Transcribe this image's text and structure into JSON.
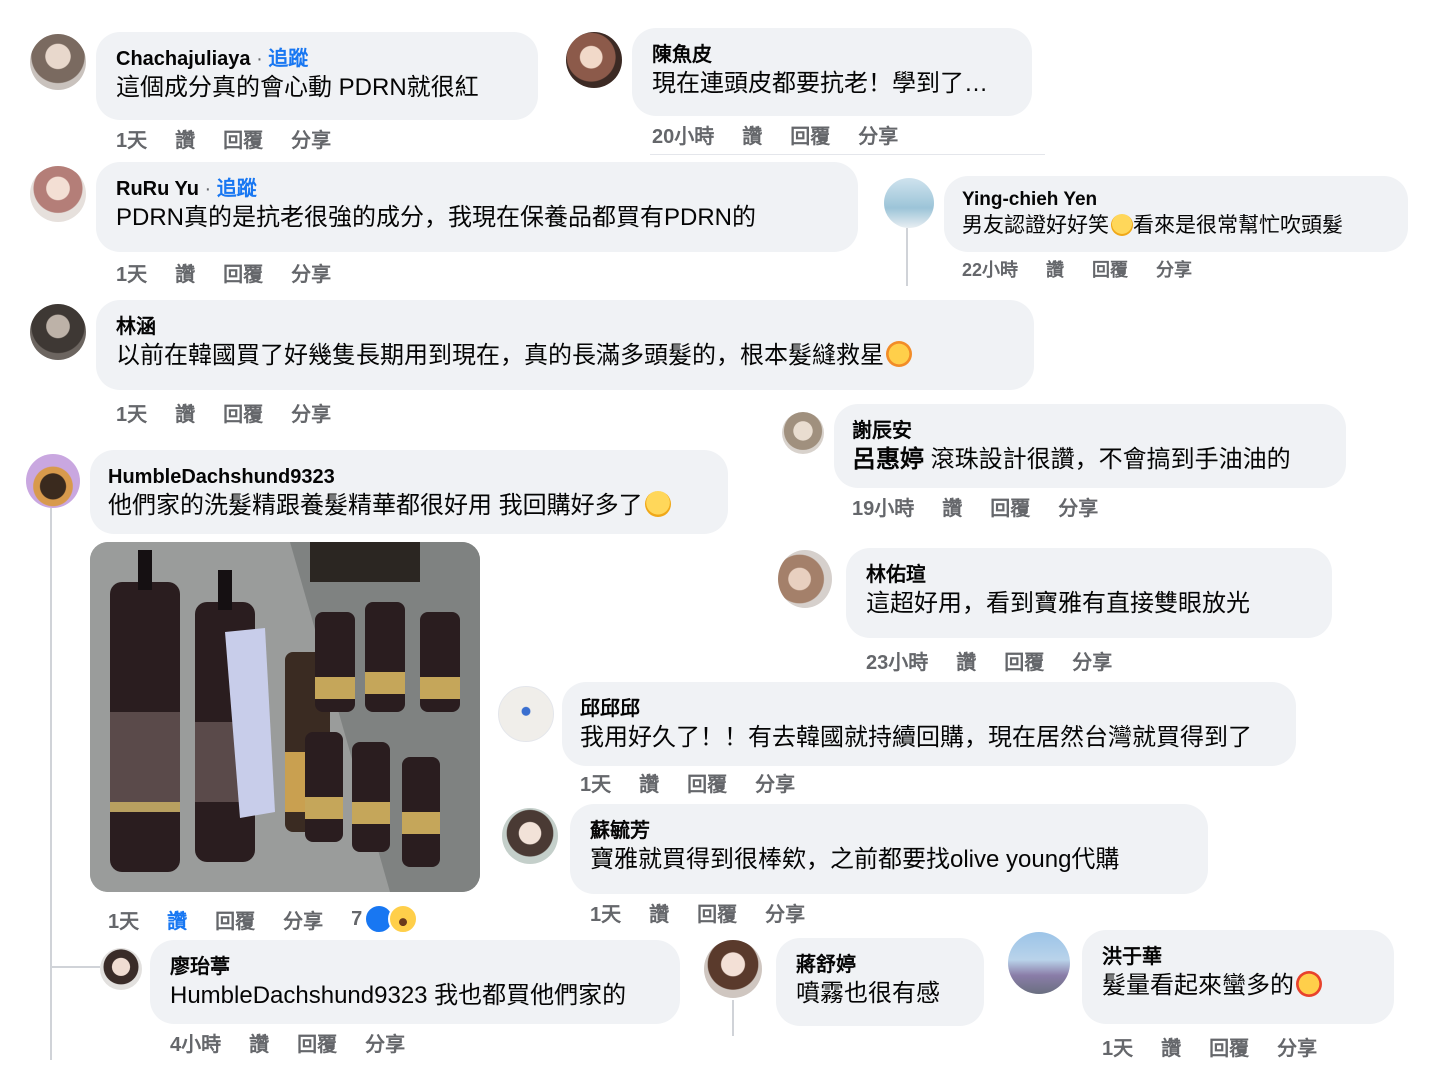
{
  "comments": [
    {
      "name": "Chachajuliaya",
      "follow": "追蹤",
      "text": "這個成分真的會心動 PDRN就很紅",
      "time": "1天",
      "like": "讚",
      "reply": "回覆",
      "share": "分享"
    },
    {
      "name": "陳魚皮",
      "text": "現在連頭皮都要抗老！學到了…",
      "time": "20小時",
      "like": "讚",
      "reply": "回覆",
      "share": "分享"
    },
    {
      "name": "RuRu Yu",
      "follow": "追蹤",
      "text": "PDRN真的是抗老很強的成分，我現在保養品都買有PDRN的",
      "time": "1天",
      "like": "讚",
      "reply": "回覆",
      "share": "分享"
    },
    {
      "name": "Ying-chieh Yen",
      "text_a": "男友認證好好笑",
      "text_b": "看來是很常幫忙吹頭髮",
      "time": "22小時",
      "like": "讚",
      "reply": "回覆",
      "share": "分享"
    },
    {
      "name": "林涵",
      "text": "以前在韓國買了好幾隻長期用到現在，真的長滿多頭髮的，根本髮縫救星",
      "time": "1天",
      "like": "讚",
      "reply": "回覆",
      "share": "分享"
    },
    {
      "name": "謝辰安",
      "mention": "呂惠婷",
      "text": "滾珠設計很讚，不會搞到手油油的",
      "time": "19小時",
      "like": "讚",
      "reply": "回覆",
      "share": "分享"
    },
    {
      "name": "HumbleDachshund9323",
      "text": "他們家的洗髮精跟養髮精華都很好用 我回購好多了",
      "time": "1天",
      "like": "讚",
      "reply": "回覆",
      "share": "分享",
      "reactions": "7"
    },
    {
      "name": "林佑瑄",
      "text": "這超好用，看到寶雅有直接雙眼放光",
      "time": "23小時",
      "like": "讚",
      "reply": "回覆",
      "share": "分享"
    },
    {
      "name": "邱邱邱",
      "text": "我用好久了！！有去韓國就持續回購，現在居然台灣就買得到了",
      "time": "1天",
      "like": "讚",
      "reply": "回覆",
      "share": "分享"
    },
    {
      "name": "蘇毓芳",
      "text": "寶雅就買得到很棒欸，之前都要找olive young代購",
      "time": "1天",
      "like": "讚",
      "reply": "回覆",
      "share": "分享"
    },
    {
      "name": "廖珆葶",
      "text": "HumbleDachshund9323 我也都買他們家的",
      "time": "4小時",
      "like": "讚",
      "reply": "回覆",
      "share": "分享"
    },
    {
      "name": "蔣舒婷",
      "text": "噴霧也很有感"
    },
    {
      "name": "洪于華",
      "text": "髮量看起來蠻多的",
      "time": "1天",
      "like": "讚",
      "reply": "回覆",
      "share": "分享"
    }
  ],
  "colors": {
    "bubble": "#f0f2f5",
    "link": "#1877f2",
    "meta": "#65676b"
  }
}
